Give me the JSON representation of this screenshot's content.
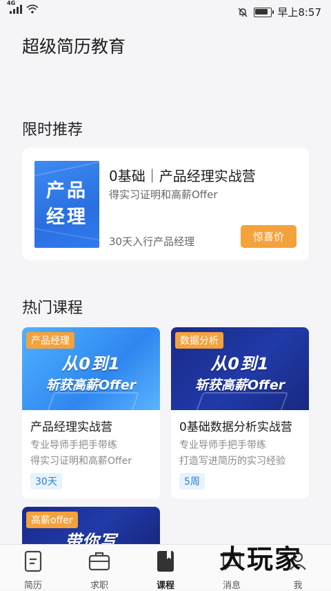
{
  "status_bar": {
    "network": "4G",
    "time": "早上8:57"
  },
  "app": {
    "title": "超级简历教育"
  },
  "sections": {
    "promo_title": "限时推荐",
    "hot_title": "热门课程"
  },
  "promo": {
    "thumb_line1": "产品",
    "thumb_line2": "经理",
    "title": "0基础｜产品经理实战营",
    "subtitle": "得实习证明和高薪Offer",
    "footer": "30天入行产品经理",
    "button": "惊喜价"
  },
  "courses": [
    {
      "tag": "产品经理",
      "banner_line1": "从0到1",
      "banner_line2": "斩获高薪Offer",
      "name": "产品经理实战营",
      "desc1": "专业导师手把手带练",
      "desc2": "得实习证明和高薪Offer",
      "duration": "30天"
    },
    {
      "tag": "数据分析",
      "banner_line1": "从0到1",
      "banner_line2": "斩获高薪Offer",
      "name": "0基础数据分析实战营",
      "desc1": "专业导师手把手带练",
      "desc2": "打造写进简历的实习经验",
      "duration": "5周"
    },
    {
      "tag": "高薪offer",
      "banner_line1": "带你写"
    }
  ],
  "tabs": [
    {
      "label": "简历",
      "icon": "resume-icon"
    },
    {
      "label": "求职",
      "icon": "briefcase-icon"
    },
    {
      "label": "课程",
      "icon": "book-icon"
    },
    {
      "label": "消息",
      "icon": "message-icon"
    },
    {
      "label": "我",
      "icon": "profile-icon"
    }
  ],
  "active_tab": "课程",
  "watermark": "大玩家",
  "colors": {
    "accent": "#f4a23c",
    "chip_text": "#2f7fd0",
    "chip_bg": "#e8f3fc"
  }
}
